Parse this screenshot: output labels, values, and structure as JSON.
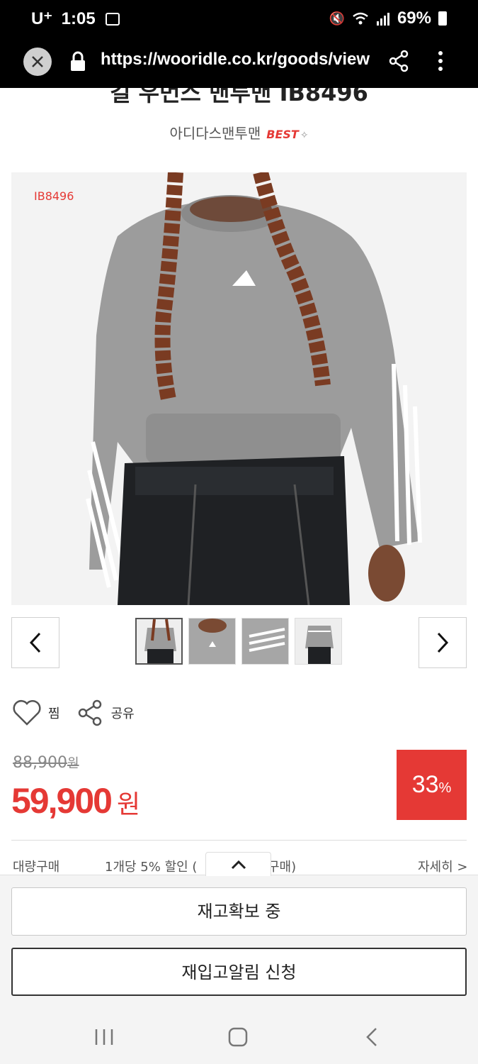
{
  "status_bar": {
    "carrier": "U⁺",
    "time": "1:05",
    "battery": "69%"
  },
  "browser": {
    "url": "https://wooridle.co.kr/goods/view"
  },
  "product": {
    "title_partial": "길 우먼스 맨투맨 IB8496",
    "brand": "아디다스맨투맨",
    "best_badge": "BEST",
    "image_code": "IB8496",
    "colors": {
      "sweater": "#9c9c9c",
      "pants": "#1f2124",
      "skin": "#7a4a33",
      "accent": "#e53935"
    }
  },
  "actions": {
    "wish_label": "찜",
    "share_label": "공유"
  },
  "pricing": {
    "original": "88,900",
    "original_unit": "원",
    "sale": "59,900",
    "sale_unit": "원",
    "discount": "33",
    "discount_unit": "%"
  },
  "bulk": {
    "label": "대량구매",
    "desc_left": "1개당 5% 할인 (",
    "desc_right": "구매)",
    "more": "자세히 >"
  },
  "buttons": {
    "stock": "재고확보 중",
    "restock_alert": "재입고알림 신청"
  }
}
